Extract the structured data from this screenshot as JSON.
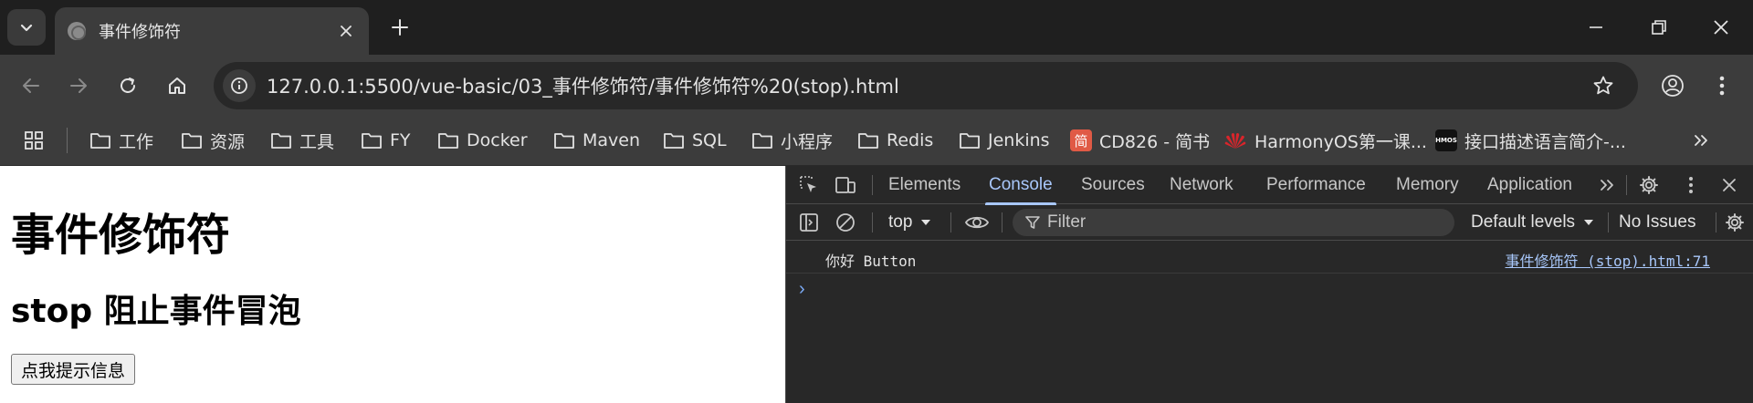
{
  "browser": {
    "tab_title": "事件修饰符",
    "url": "127.0.0.1:5500/vue-basic/03_事件修饰符/事件修饰符%20(stop).html"
  },
  "bookmarks": [
    {
      "label": "工作",
      "icon": "folder-icon"
    },
    {
      "label": "资源",
      "icon": "folder-icon"
    },
    {
      "label": "工具",
      "icon": "folder-icon"
    },
    {
      "label": "FY",
      "icon": "folder-icon"
    },
    {
      "label": "Docker",
      "icon": "folder-icon"
    },
    {
      "label": "Maven",
      "icon": "folder-icon"
    },
    {
      "label": "SQL",
      "icon": "folder-icon"
    },
    {
      "label": "小程序",
      "icon": "folder-icon"
    },
    {
      "label": "Redis",
      "icon": "folder-icon"
    },
    {
      "label": "Jenkins",
      "icon": "folder-icon"
    },
    {
      "label": "CD826 - 简书",
      "icon": "jianshu-icon",
      "badge": "简"
    },
    {
      "label": "HarmonyOS第一课...",
      "icon": "huawei-icon"
    },
    {
      "label": "接口描述语言简介-...",
      "icon": "hmos-icon",
      "badge": "HMOS"
    }
  ],
  "page": {
    "heading": "事件修饰符",
    "subheading": "stop 阻止事件冒泡",
    "button_label": "点我提示信息"
  },
  "devtools": {
    "tabs": [
      "Elements",
      "Console",
      "Sources",
      "Network",
      "Performance",
      "Memory",
      "Application"
    ],
    "active_tab": "Console",
    "context": "top",
    "filter_placeholder": "Filter",
    "levels": "Default levels",
    "issues": "No Issues",
    "log": {
      "message": "你好 Button",
      "source": "事件修饰符 (stop).html:71"
    },
    "prompt": "›"
  },
  "colors": {
    "accent": "#a8c7fa",
    "toolbar": "#3c3c3c",
    "tabstrip": "#1f1f1f"
  }
}
